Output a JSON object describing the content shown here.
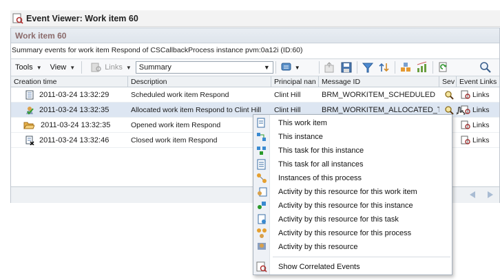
{
  "window": {
    "title": "Event Viewer: Work item 60"
  },
  "panel": {
    "heading": "Work item 60",
    "summary": "Summary events for work item Respond of CSCallbackProcess instance pvm:0a12i (ID:60)"
  },
  "toolbar": {
    "tools_label": "Tools",
    "view_label": "View",
    "links_label": "Links",
    "view_select_value": "Summary"
  },
  "table": {
    "columns": [
      "Creation time",
      "Description",
      "Principal nan",
      "Message ID",
      "Sev",
      "Event Links"
    ],
    "rows": [
      {
        "time": "2011-03-24 13:32:29",
        "description": "Scheduled work item Respond",
        "principal": "Clint Hill",
        "message_id": "BRM_WORKITEM_SCHEDULED",
        "links": "Links"
      },
      {
        "time": "2011-03-24 13:32:35",
        "description": "Allocated work item Respond to Clint Hill",
        "principal": "Clint Hill",
        "message_id": "BRM_WORKITEM_ALLOCATED_TC",
        "links": "Links"
      },
      {
        "time": "2011-03-24 13:32:35",
        "description": "Opened work item Respond",
        "principal": "",
        "message_id": "",
        "links": "Links"
      },
      {
        "time": "2011-03-24 13:32:46",
        "description": "Closed work item Respond",
        "principal": "",
        "message_id": "",
        "links": "Links"
      }
    ]
  },
  "context_menu": {
    "items": [
      "This work item",
      "This instance",
      "This task for this instance",
      "This task for all instances",
      "Instances of this process",
      "Activity by this resource for this work item",
      "Activity by this resource for this instance",
      "Activity by this resource for this task",
      "Activity by this resource for this process",
      "Activity by this resource"
    ],
    "footer_item": "Show Correlated Events"
  },
  "colors": {
    "accent": "#3a6ea5",
    "selected_row": "#dde6f2",
    "heading": "#8b6b6b"
  }
}
